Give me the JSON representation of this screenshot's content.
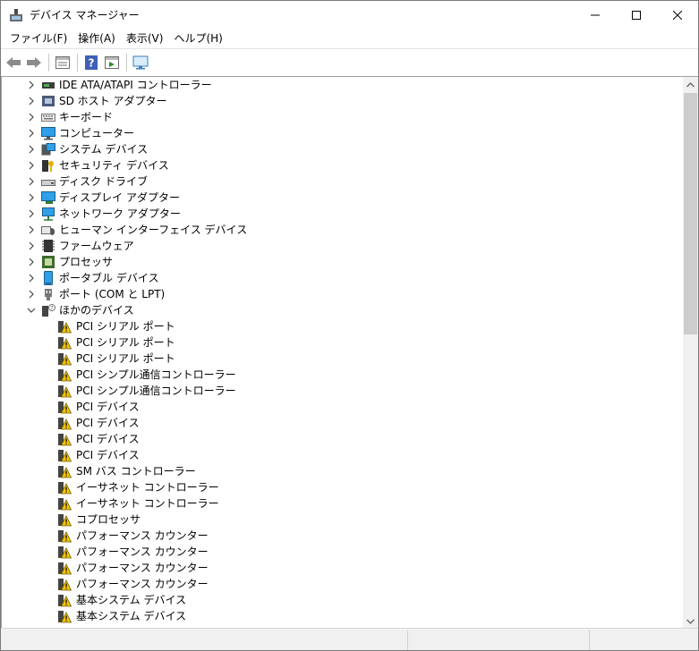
{
  "window": {
    "title": "デバイス マネージャー"
  },
  "menu": [
    "ファイル(F)",
    "操作(A)",
    "表示(V)",
    "ヘルプ(H)"
  ],
  "toolbar": {
    "buttons": [
      "back-icon",
      "forward-icon",
      "properties-icon",
      "help-icon",
      "view-icon",
      "monitor-icon"
    ]
  },
  "categories": [
    {
      "label": "IDE ATA/ATAPI コントローラー",
      "icon": "ide-controller-icon"
    },
    {
      "label": "SD ホスト アダプター",
      "icon": "sd-host-icon"
    },
    {
      "label": "キーボード",
      "icon": "keyboard-icon"
    },
    {
      "label": "コンピューター",
      "icon": "computer-icon"
    },
    {
      "label": "システム デバイス",
      "icon": "system-device-icon"
    },
    {
      "label": "セキュリティ デバイス",
      "icon": "security-device-icon"
    },
    {
      "label": "ディスク ドライブ",
      "icon": "disk-drive-icon"
    },
    {
      "label": "ディスプレイ アダプター",
      "icon": "display-adapter-icon"
    },
    {
      "label": "ネットワーク アダプター",
      "icon": "network-adapter-icon"
    },
    {
      "label": "ヒューマン インターフェイス デバイス",
      "icon": "hid-icon"
    },
    {
      "label": "ファームウェア",
      "icon": "firmware-icon"
    },
    {
      "label": "プロセッサ",
      "icon": "processor-icon"
    },
    {
      "label": "ポータブル デバイス",
      "icon": "portable-device-icon"
    },
    {
      "label": "ポート (COM と LPT)",
      "icon": "port-icon"
    }
  ],
  "expanded_category": {
    "label": "ほかのデバイス",
    "icon": "other-devices-icon"
  },
  "other_devices": [
    "PCI シリアル ポート",
    "PCI シリアル ポート",
    "PCI シリアル ポート",
    "PCI シンプル通信コントローラー",
    "PCI シンプル通信コントローラー",
    "PCI デバイス",
    "PCI デバイス",
    "PCI デバイス",
    "PCI デバイス",
    "SM バス コントローラー",
    "イーサネット コントローラー",
    "イーサネット コントローラー",
    "コプロセッサ",
    "パフォーマンス カウンター",
    "パフォーマンス カウンター",
    "パフォーマンス カウンター",
    "パフォーマンス カウンター",
    "基本システム デバイス",
    "基本システム デバイス"
  ],
  "colors": {
    "warning": "#f5c400",
    "accent": "#0078d7"
  }
}
